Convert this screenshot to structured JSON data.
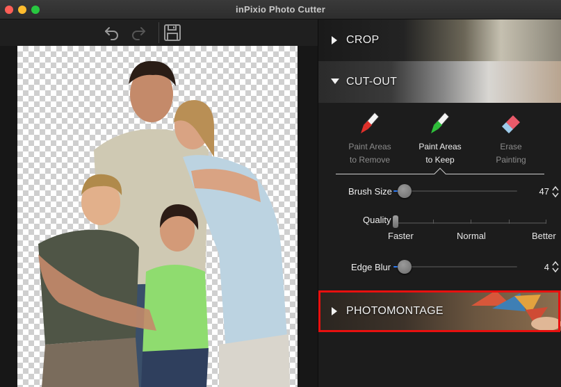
{
  "window": {
    "title": "inPixio Photo Cutter"
  },
  "toolbar": {
    "undo": "undo-icon",
    "redo": "redo-icon",
    "save": "save-icon"
  },
  "panel": {
    "crop": {
      "label": "CROP",
      "expanded": false
    },
    "cutout": {
      "label": "CUT-OUT",
      "expanded": true,
      "tools": [
        {
          "line1": "Paint Areas",
          "line2": "to Remove",
          "icon": "red-marker-icon",
          "active": false
        },
        {
          "line1": "Paint Areas",
          "line2": "to Keep",
          "icon": "green-marker-icon",
          "active": true
        },
        {
          "line1": "Erase",
          "line2": "Painting",
          "icon": "eraser-icon",
          "active": false
        }
      ],
      "brush_size": {
        "label": "Brush Size",
        "value": "47"
      },
      "quality": {
        "label": "Quality",
        "min_label": "Faster",
        "mid_label": "Normal",
        "max_label": "Better"
      },
      "edge_blur": {
        "label": "Edge Blur",
        "value": "4"
      }
    },
    "photomontage": {
      "label": "PHOTOMONTAGE",
      "expanded": false,
      "highlighted": true
    }
  },
  "colors": {
    "accent": "#2e7cf6",
    "highlight": "#e8100f",
    "remove": "#e0302a",
    "keep": "#2fbf3a"
  }
}
